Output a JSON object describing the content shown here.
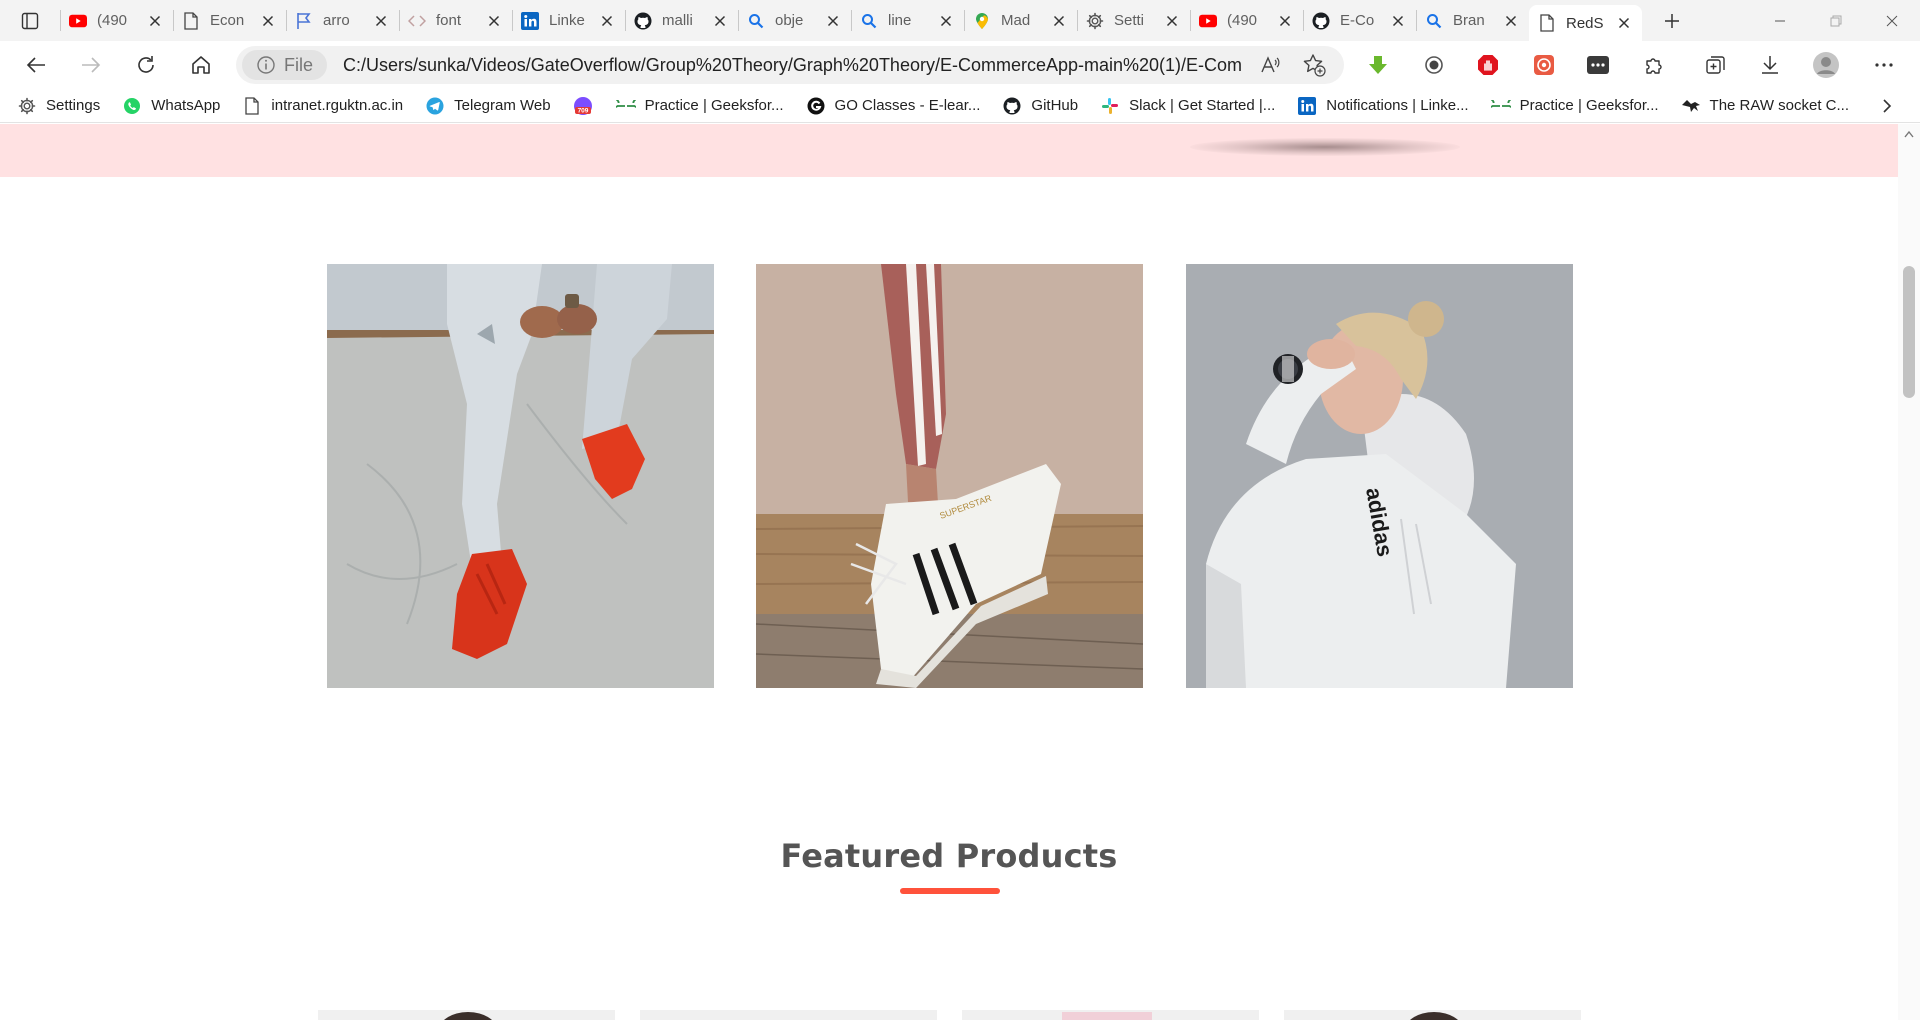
{
  "browser": {
    "tabs": [
      {
        "title": "(490",
        "icon": "youtube-icon"
      },
      {
        "title": "Econ",
        "icon": "page-icon"
      },
      {
        "title": "arro",
        "icon": "flag-icon"
      },
      {
        "title": "font",
        "icon": "code-icon"
      },
      {
        "title": "Linke",
        "icon": "linkedin-icon"
      },
      {
        "title": "malli",
        "icon": "github-icon"
      },
      {
        "title": "obje",
        "icon": "search-icon"
      },
      {
        "title": "line",
        "icon": "search-icon"
      },
      {
        "title": "Mad",
        "icon": "maps-icon"
      },
      {
        "title": "Setti",
        "icon": "gear-icon"
      },
      {
        "title": "(490",
        "icon": "youtube-icon"
      },
      {
        "title": "E-Co",
        "icon": "github-icon"
      },
      {
        "title": "Bran",
        "icon": "search-icon"
      },
      {
        "title": "RedS",
        "icon": "page-icon",
        "active": true
      }
    ],
    "site_info_label": "File",
    "url": "C:/Users/sunka/Videos/GateOverflow/Group%20Theory/Graph%20Theory/E-CommerceApp-main%20(1)/E-Comme...",
    "bookmarks": [
      {
        "label": "Settings",
        "icon": "gear-icon"
      },
      {
        "label": "WhatsApp",
        "icon": "whatsapp-icon"
      },
      {
        "label": "intranet.rguktn.ac.in",
        "icon": "page-icon"
      },
      {
        "label": "Telegram Web",
        "icon": "telegram-icon"
      },
      {
        "label": "",
        "icon": "badge-icon",
        "badge": "709"
      },
      {
        "label": "Practice | Geeksfor...",
        "icon": "geeksforgeeks-icon"
      },
      {
        "label": "GO Classes - E-lear...",
        "icon": "goclasses-icon"
      },
      {
        "label": "GitHub",
        "icon": "github-icon"
      },
      {
        "label": "Slack | Get Started |...",
        "icon": "slack-icon"
      },
      {
        "label": "Notifications | Linke...",
        "icon": "linkedin-icon"
      },
      {
        "label": "Practice | Geeksfor...",
        "icon": "geeksforgeeks-icon"
      },
      {
        "label": "The RAW socket C...",
        "icon": "raw-socket-icon"
      }
    ]
  },
  "page": {
    "categories": [
      {
        "name": "red-sneakers-photo",
        "text": ""
      },
      {
        "name": "superstar-sneaker-photo",
        "text": "SUPERSTAR"
      },
      {
        "name": "adidas-hoodie-photo",
        "text": "adidas"
      }
    ],
    "featured_title": "Featured Products",
    "accent_color": "#ff523b",
    "hero_color": "#ffe1e2"
  }
}
